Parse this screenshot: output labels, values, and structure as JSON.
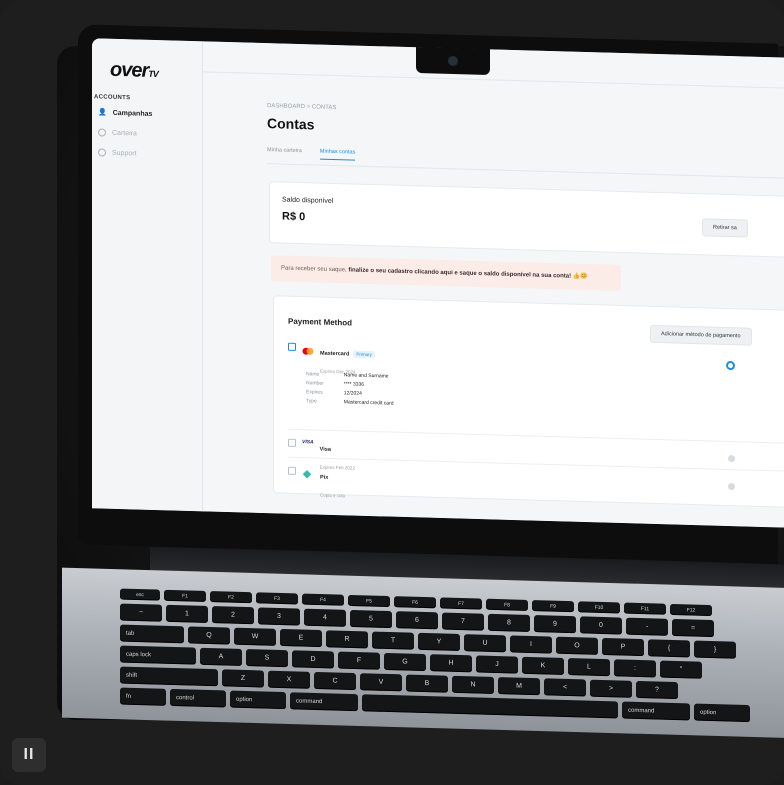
{
  "app": {
    "logo_main": "over",
    "logo_sub": "TV"
  },
  "sidebar": {
    "section_title": "ACCOUNTS",
    "items": [
      {
        "label": "Campanhas",
        "active": true
      },
      {
        "label": "Carteira",
        "active": false
      },
      {
        "label": "Support",
        "active": false
      }
    ]
  },
  "header": {
    "breadcrumb_root": "DASHBOARD",
    "breadcrumb_sep": ">",
    "breadcrumb_current": "CONTAS",
    "title": "Contas"
  },
  "tabs": [
    {
      "label": "Minha carteira",
      "active": false
    },
    {
      "label": "Minhas contas",
      "active": true
    }
  ],
  "balance": {
    "label": "Saldo disponível",
    "value": "R$ 0",
    "withdraw_button": "Retirar sa"
  },
  "alert": {
    "text_start": "Para receber seu saque, ",
    "text_bold": "finalize o seu cadastro clicando aqui e saque o saldo disponível na sua conta!",
    "emoji": " 👍😊"
  },
  "payment": {
    "title": "Payment Method",
    "add_button": "Adicionar método de pagamento",
    "methods": [
      {
        "name": "Mastercard",
        "badge": "Primary",
        "sub": "Expires Dec 2024",
        "selected": true
      },
      {
        "name": "Visa",
        "brand_label": "VISA",
        "sub": "Expires Feb 2022",
        "selected": false
      },
      {
        "name": "Pix",
        "sub": "Copia e cola",
        "selected": false
      }
    ],
    "details": {
      "name_label": "Name",
      "name_value": "Name and Surname",
      "number_label": "Number",
      "number_value": "**** 3336",
      "expires_label": "Expires",
      "expires_value": "12/2024",
      "type_label": "Type",
      "type_value": "Mastercard credit card"
    }
  },
  "keyboard": {
    "fn_row": [
      "esc",
      "F1",
      "F2",
      "F3",
      "F4",
      "F5",
      "F6",
      "F7",
      "F8",
      "F9",
      "F10",
      "F11",
      "F12"
    ],
    "row1": [
      "~",
      "1",
      "2",
      "3",
      "4",
      "5",
      "6",
      "7",
      "8",
      "9",
      "0",
      "-",
      "="
    ],
    "row2_lead": "tab",
    "row2": [
      "Q",
      "W",
      "E",
      "R",
      "T",
      "Y",
      "U",
      "I",
      "O",
      "P",
      "{",
      "}"
    ],
    "row3_lead": "caps lock",
    "row3": [
      "A",
      "S",
      "D",
      "F",
      "G",
      "H",
      "J",
      "K",
      "L",
      ":",
      "\""
    ],
    "row4_lead": "shift",
    "row4": [
      "Z",
      "X",
      "C",
      "V",
      "B",
      "N",
      "M",
      "<",
      ">",
      "?"
    ],
    "row5": [
      "fn",
      "control",
      "option",
      "command",
      "",
      "command",
      "option"
    ]
  },
  "controls": {
    "pause": "II"
  },
  "colors": {
    "accent": "#1a8fe0",
    "alert_bg": "#fbece8",
    "mastercard_red": "#eb001b",
    "mastercard_orange": "#f79e1b",
    "pix_teal": "#32bcad"
  }
}
